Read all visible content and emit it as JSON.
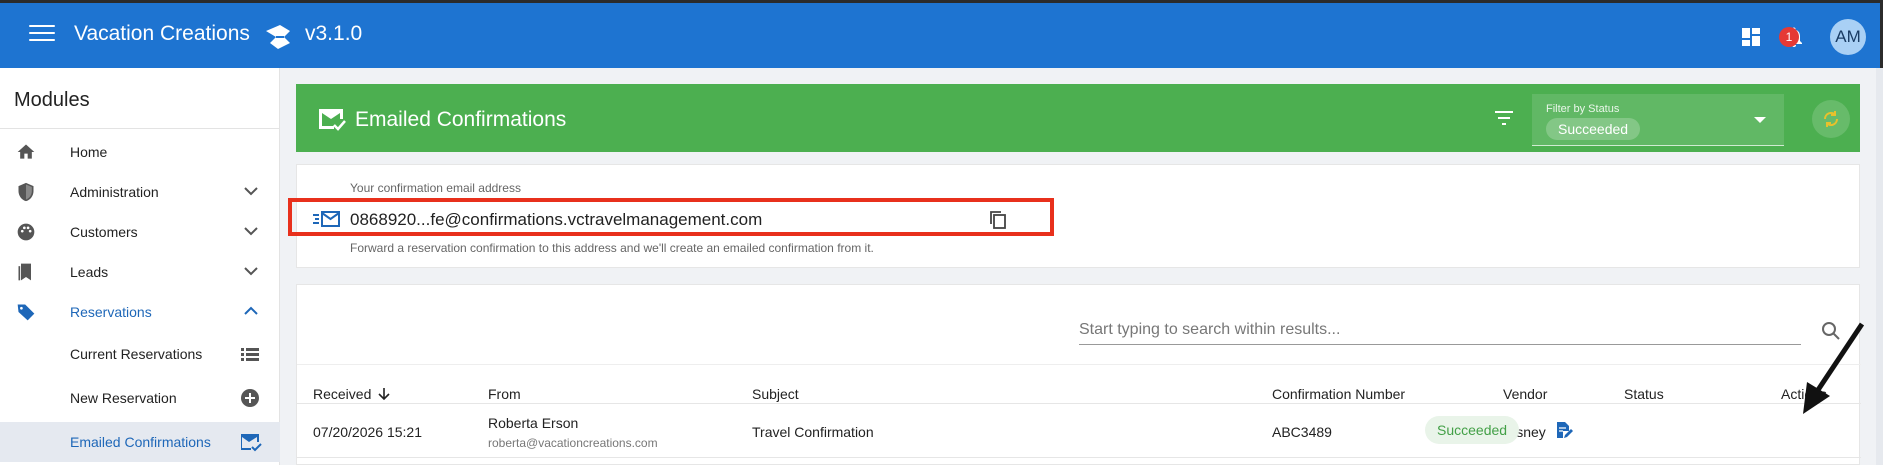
{
  "app": {
    "title": "Vacation Creations",
    "version": "v3.1.0",
    "notification_count": "1",
    "user_initials": "AM"
  },
  "sidebar": {
    "heading": "Modules",
    "items": [
      {
        "label": "Home",
        "icon": "home-icon"
      },
      {
        "label": "Administration",
        "icon": "shield-icon"
      },
      {
        "label": "Customers",
        "icon": "palette-icon"
      },
      {
        "label": "Leads",
        "icon": "bookmark-icon"
      },
      {
        "label": "Reservations",
        "icon": "tag-icon"
      },
      {
        "label": "Current Reservations",
        "icon": "list-icon"
      },
      {
        "label": "New Reservation",
        "icon": "add-circle-icon"
      },
      {
        "label": "Emailed Confirmations",
        "icon": "mark-email-read-icon"
      }
    ]
  },
  "panel": {
    "title": "Emailed Confirmations",
    "filter_label": "Filter by Status",
    "filter_value": "Succeeded"
  },
  "email": {
    "caption": "Your confirmation email address",
    "address": "0868920...fe@confirmations.vctravelmanagement.com",
    "forward_note": "Forward a reservation confirmation to this address and we'll create an emailed confirmation from it."
  },
  "table": {
    "search_placeholder": "Start typing to search within results...",
    "headers": {
      "received": "Received",
      "from": "From",
      "subject": "Subject",
      "confirmation": "Confirmation Number",
      "vendor": "Vendor",
      "status": "Status",
      "actions": "Actions"
    },
    "rows": [
      {
        "received": "07/20/2026 15:21",
        "from_name": "Roberta Erson",
        "from_email": "roberta@vacationcreations.com",
        "subject": "Travel Confirmation",
        "confirmation": "ABC3489",
        "vendor": "Disney",
        "status": "Succeeded"
      }
    ]
  },
  "colors": {
    "appbar": "#1e74d1",
    "panel_header": "#4caf50",
    "highlight": "#e8301c",
    "status_success": "#43a047"
  }
}
